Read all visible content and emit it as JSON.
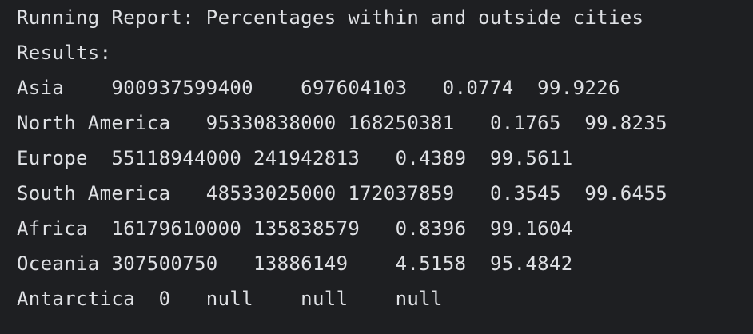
{
  "console": {
    "lines": [
      "Running Report: Percentages within and outside cities",
      "Results:",
      "Asia    900937599400    697604103   0.0774  99.9226",
      "North America   95330838000 168250381   0.1765  99.8235",
      "Europe  55118944000 241942813   0.4389  99.5611",
      "South America   48533025000 172037859   0.3545  99.6455",
      "Africa  16179610000 135838579   0.8396  99.1604",
      "Oceania 307500750   13886149    4.5158  95.4842",
      "Antarctica  0   null    null    null"
    ]
  }
}
